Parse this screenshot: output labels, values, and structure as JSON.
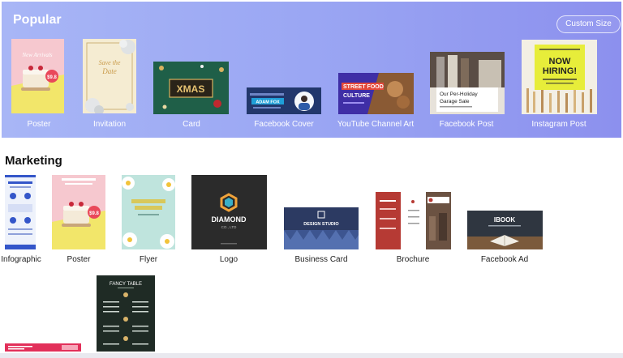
{
  "popular": {
    "title": "Popular",
    "custom_size_label": "Custom Size",
    "items": [
      {
        "label": "Poster",
        "art_title": "New Arrivals",
        "art_price": "$9.8"
      },
      {
        "label": "Invitation",
        "art_title_1": "Save the",
        "art_title_2": "Date"
      },
      {
        "label": "Card",
        "art_text": "XMAS"
      },
      {
        "label": "Facebook Cover",
        "art_text": "ADAM FOX"
      },
      {
        "label": "YouTube Channel Art",
        "art_text_1": "STREET FOOD",
        "art_text_2": "CULTURE"
      },
      {
        "label": "Facebook Post",
        "art_text_1": "Our Per-Holiday",
        "art_text_2": "Garage Sale"
      },
      {
        "label": "Instagram Post",
        "art_text_1": "NOW",
        "art_text_2": "HIRING!"
      }
    ]
  },
  "marketing": {
    "title": "Marketing",
    "items": [
      {
        "label": "Infographic"
      },
      {
        "label": "Poster",
        "art_price": "$9.8"
      },
      {
        "label": "Flyer"
      },
      {
        "label": "Logo",
        "art_text_1": "DIAMOND",
        "art_text_2": "CO., LTD"
      },
      {
        "label": "Business Card",
        "art_text": "DESIGN STUDIO"
      },
      {
        "label": "Brochure"
      },
      {
        "label": "Facebook Ad",
        "art_text": "IBOOK"
      },
      {
        "label": "",
        "art_text": "FANCY TABLE"
      }
    ]
  },
  "colors": {
    "hero_start": "#a8b6f6",
    "hero_end": "#8c90ee",
    "card_green": "#1f5f48",
    "logo_dark": "#2b2b2b",
    "insta_yellow": "#e7ed3a"
  }
}
